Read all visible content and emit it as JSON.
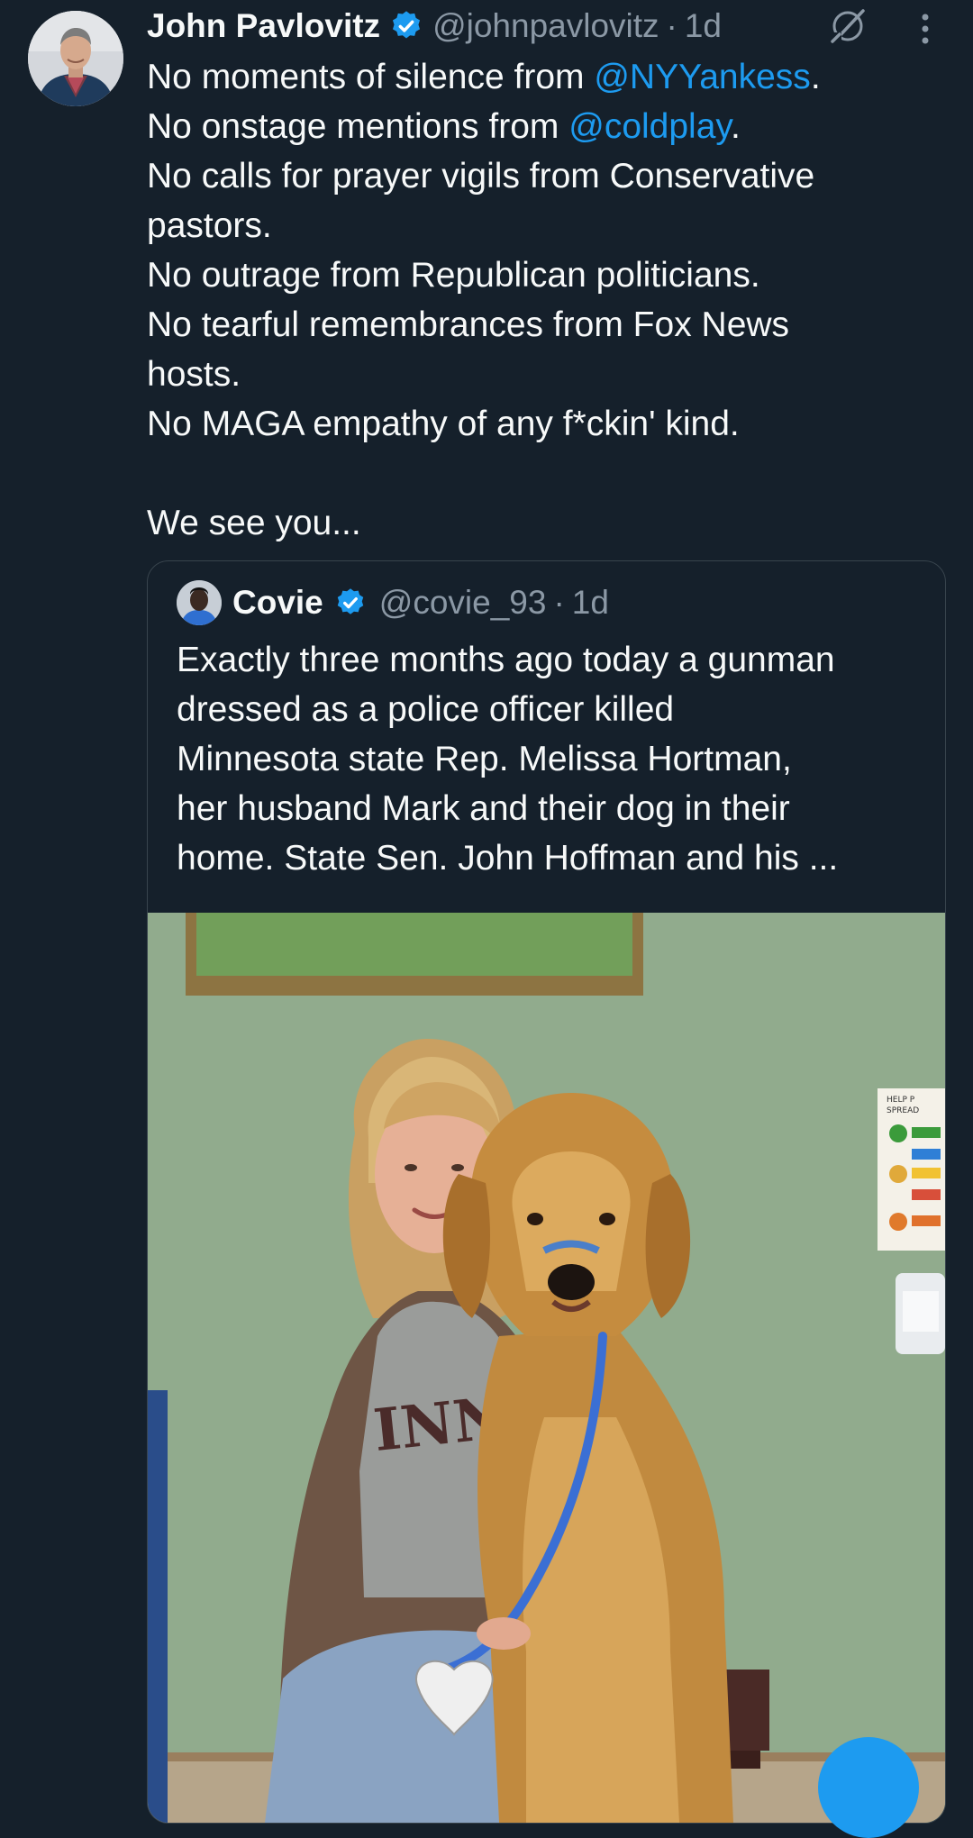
{
  "tweet": {
    "author_name": "John Pavlovitz",
    "handle": "@johnpavlovitz",
    "separator": "·",
    "time": "1d",
    "lines": [
      {
        "pre": "No moments of silence from ",
        "mention": "@NYYankess",
        "post": "."
      },
      {
        "pre": "No onstage mentions from ",
        "mention": "@coldplay",
        "post": "."
      },
      {
        "pre": "No calls for prayer vigils from Conservative"
      },
      {
        "pre": "pastors."
      },
      {
        "pre": "No outrage from Republican politicians."
      },
      {
        "pre": "No tearful remembrances from Fox News"
      },
      {
        "pre": "hosts."
      },
      {
        "pre": "No MAGA empathy of any f*ckin' kind."
      }
    ],
    "closing_line": "We see you...",
    "icons": {
      "verified": "verified-badge-icon",
      "grok": "grok-icon",
      "more": "more-vertical-icon"
    }
  },
  "quote": {
    "author_name": "Covie",
    "handle": "@covie_93",
    "separator": "·",
    "time": "1d",
    "lines": [
      "Exactly three months ago today a gunman",
      "dressed as a police officer killed",
      "Minnesota state Rep. Melissa Hortman,",
      "her husband Mark and their dog in their",
      "home. State Sen. John Hoffman and his ..."
    ],
    "photo_sign_text": [
      "HELP P",
      "SPREAD"
    ],
    "photo_shirt_text": "INNES"
  },
  "colors": {
    "background": "#15202b",
    "text": "#f7f9f9",
    "secondary": "#8b98a5",
    "accent": "#1d9bf0",
    "border": "#38444d"
  }
}
